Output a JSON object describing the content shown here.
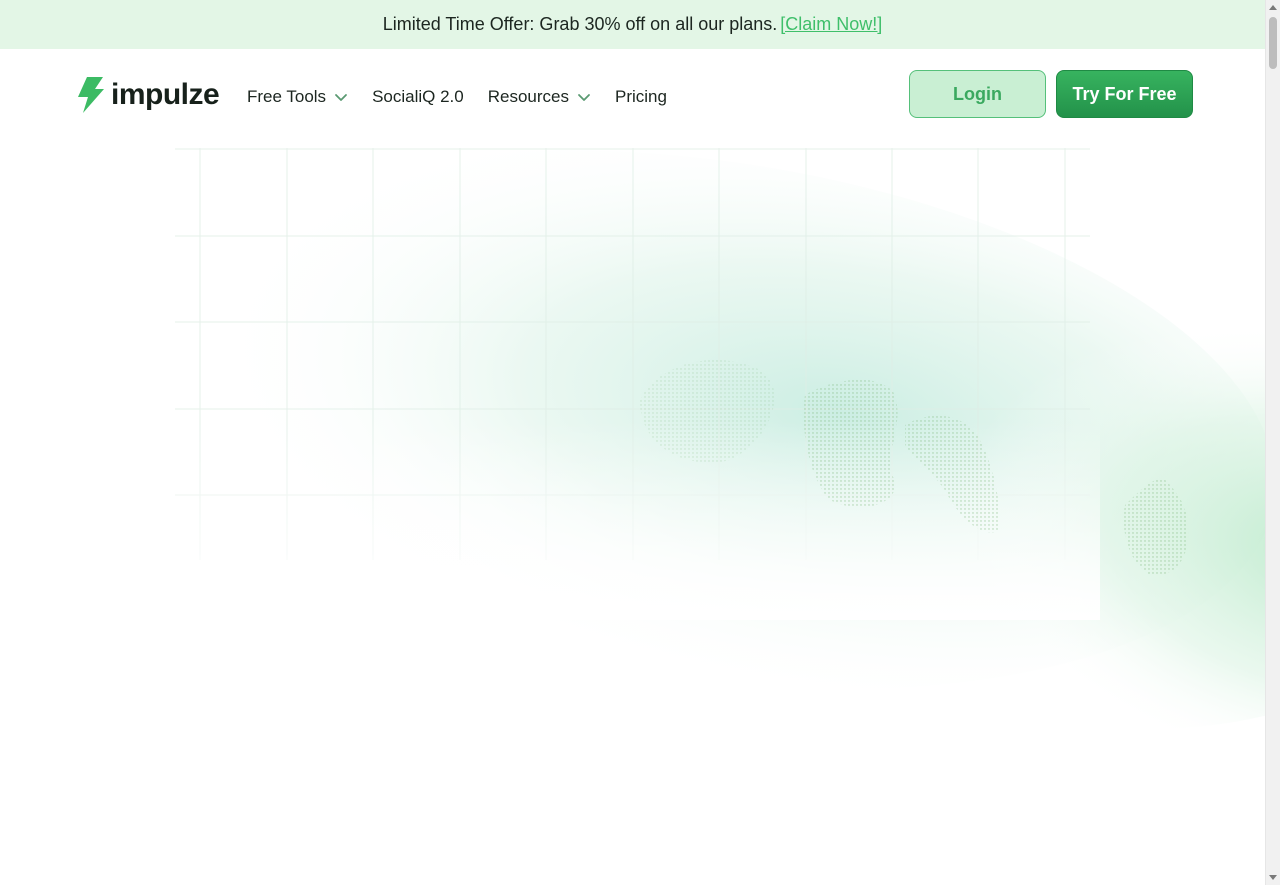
{
  "promo": {
    "text": "Limited Time Offer: Grab 30% off on all our plans.",
    "link": "[Claim Now!]"
  },
  "header": {
    "logo_text": "impulze",
    "nav": [
      {
        "label": "Free Tools",
        "dropdown": true
      },
      {
        "label": "SocialiQ 2.0",
        "dropdown": false
      },
      {
        "label": "Resources",
        "dropdown": true
      },
      {
        "label": "Pricing",
        "dropdown": false
      }
    ],
    "login_label": "Login",
    "try_label": "Try For Free"
  },
  "colors": {
    "brand_green": "#23924a",
    "accent_green": "#3fbf6a",
    "banner_bg": "#e3f6e6",
    "login_bg": "#c9efd3"
  },
  "icons": {
    "logo": "lightning-bolt-icon",
    "dropdown": "chevron-down-icon"
  }
}
